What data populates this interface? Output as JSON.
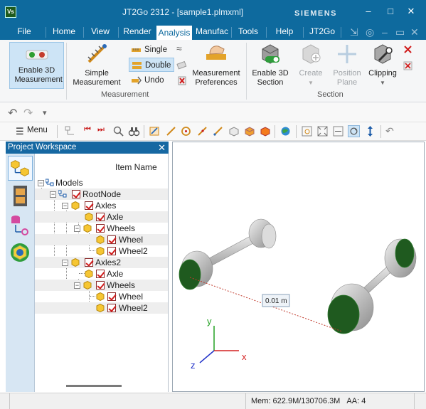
{
  "window": {
    "app_icon": "Vs",
    "title": "JT2Go 2312 - [sample1.plmxml]",
    "brand": "SIEMENS",
    "controls": {
      "minimize": "–",
      "maximize": "□",
      "close": "✕"
    }
  },
  "tabs": [
    {
      "label": "File"
    },
    {
      "label": "Home"
    },
    {
      "label": "View"
    },
    {
      "label": "Render"
    },
    {
      "label": "Analysis",
      "active": true
    },
    {
      "label": "Manufac"
    },
    {
      "label": "Tools"
    },
    {
      "label": "Help"
    },
    {
      "label": "JT2Go"
    }
  ],
  "ribbon": {
    "measurement": {
      "group_label": "Measurement",
      "enable_3d": "Enable 3D Measurement",
      "simple_measurement": "Simple Measurement",
      "single": "Single",
      "double": "Double",
      "undo": "Undo",
      "preferences": "Measurement Preferences"
    },
    "section": {
      "group_label": "Section",
      "enable_3d_section": "Enable 3D Section",
      "create": "Create",
      "position_plane": "Position Plane",
      "clipping": "Clipping"
    }
  },
  "toolbar": {
    "menu_label": "Menu"
  },
  "workspace": {
    "title": "Project Workspace",
    "close": "✕",
    "column_header": "Item Name",
    "tree": [
      {
        "label": "Models"
      },
      {
        "label": "RootNode"
      },
      {
        "label": "Axles"
      },
      {
        "label": "Axle"
      },
      {
        "label": "Wheels"
      },
      {
        "label": "Wheel"
      },
      {
        "label": "Wheel2"
      },
      {
        "label": "Axles2"
      },
      {
        "label": "Axle"
      },
      {
        "label": "Wheels"
      },
      {
        "label": "Wheel"
      },
      {
        "label": "Wheel2"
      }
    ]
  },
  "viewport": {
    "measurement_label": "0.01 m",
    "axes": {
      "x": "x",
      "y": "y",
      "z": "z"
    },
    "colors": {
      "x_axis": "#d42020",
      "y_axis": "#22a022",
      "z_axis": "#2030c8",
      "wheel_face": "#1f5a1f",
      "measure_line": "#c0392b"
    }
  },
  "status": {
    "memory": "Mem: 622.9M/130706.3M",
    "aa": "AA: 4"
  },
  "colors": {
    "accent": "#0e6a9e",
    "panel_header": "#1668a2"
  }
}
